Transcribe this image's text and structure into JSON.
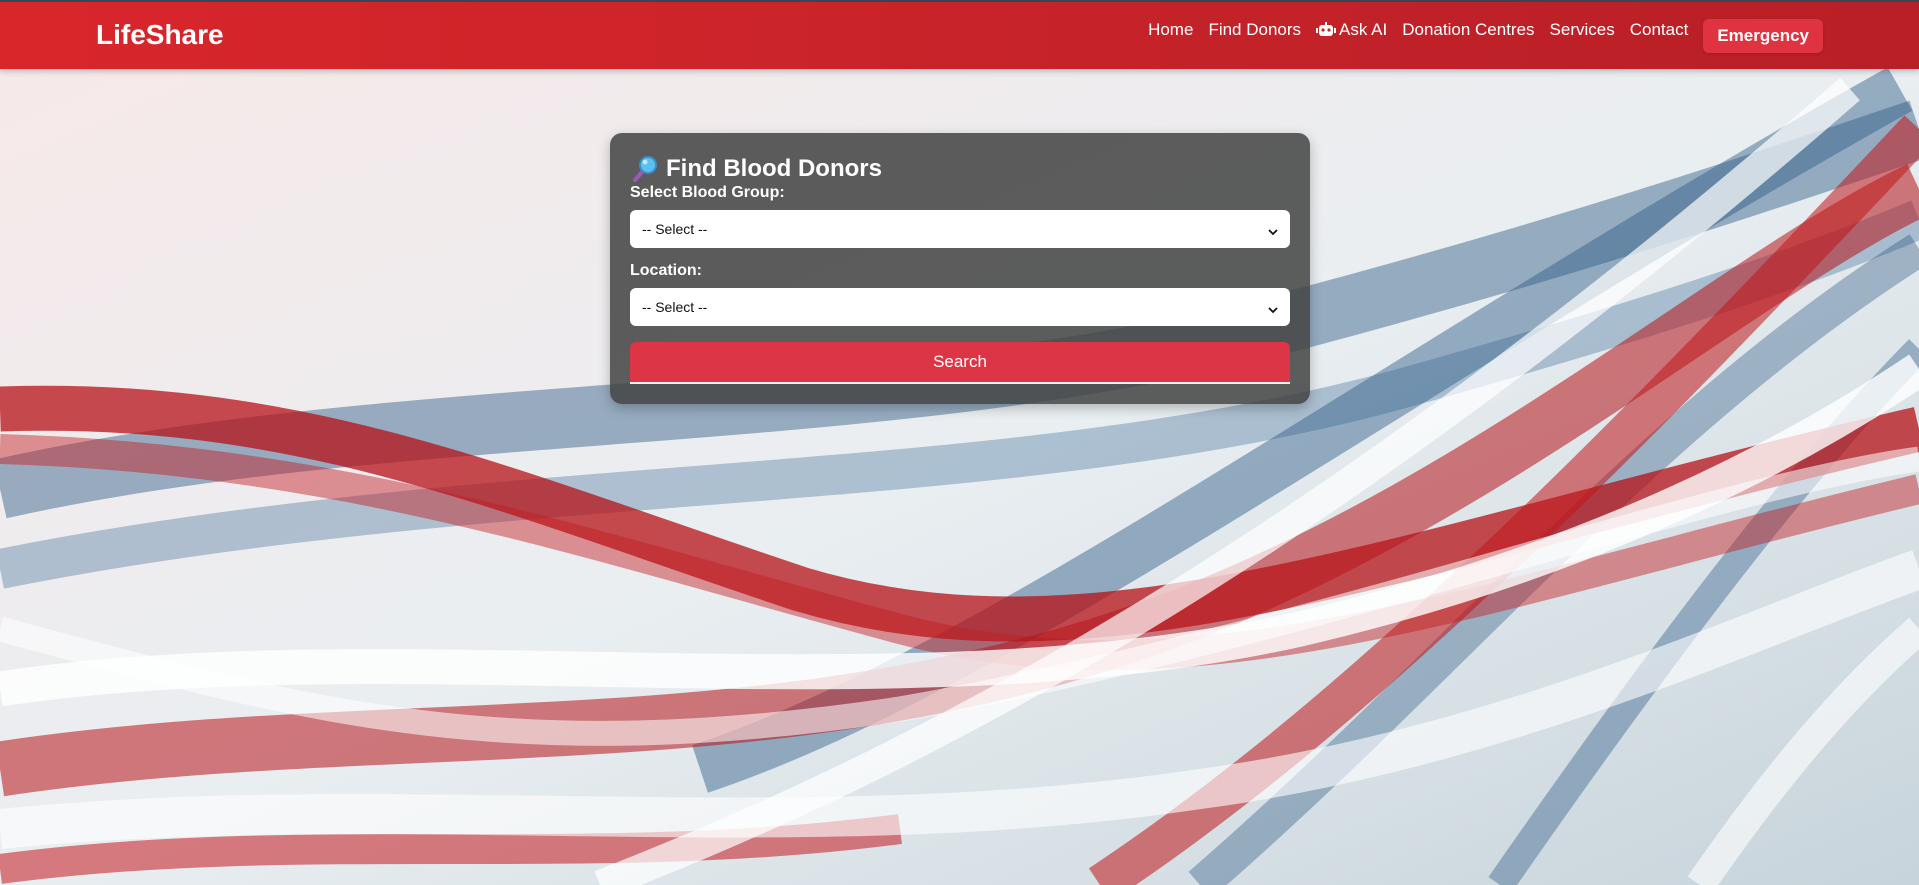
{
  "brand": "LifeShare",
  "nav": {
    "home": "Home",
    "find_donors": "Find Donors",
    "ask_ai": "Ask AI",
    "donation_centres": "Donation Centres",
    "services": "Services",
    "contact": "Contact",
    "emergency": "Emergency"
  },
  "form": {
    "title": "Find Blood Donors",
    "blood_group_label": "Select Blood Group:",
    "blood_group_value": "-- Select --",
    "location_label": "Location:",
    "location_value": "-- Select --",
    "search_label": "Search"
  },
  "colors": {
    "accent": "#c8232a",
    "button": "#dc3545",
    "card_bg": "#424242"
  },
  "icons": {
    "ask_ai": "robot-icon",
    "title": "magnifying-glass-icon",
    "select": "chevron-down-icon"
  }
}
